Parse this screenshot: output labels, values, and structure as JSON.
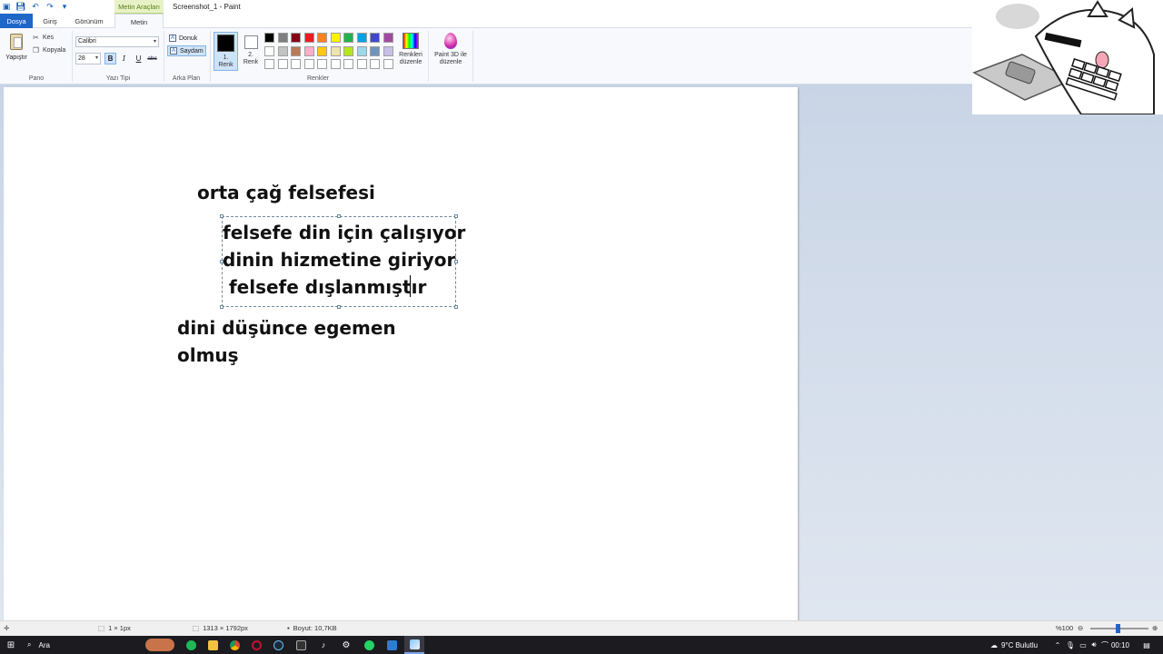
{
  "window": {
    "title": "Screenshot_1 - Paint",
    "context_tab_group": "Metin Araçları"
  },
  "tabs": {
    "file": "Dosya",
    "home": "Giriş",
    "view": "Görünüm",
    "text": "Metin"
  },
  "ribbon": {
    "clipboard": {
      "paste": "Yapıştır",
      "cut": "Kes",
      "copy": "Kopyala",
      "group": "Pano"
    },
    "font": {
      "family": "Calibri",
      "size": "28",
      "bold": "B",
      "italic": "I",
      "underline": "U",
      "strike": "abc",
      "group": "Yazı Tipi"
    },
    "background": {
      "opaque": "Donuk",
      "transparent": "Saydam",
      "group": "Arka Plan"
    },
    "colors": {
      "color1_line1": "1.",
      "color1_line2": "Renk",
      "color2_line1": "2.",
      "color2_line2": "Renk",
      "edit_line1": "Renkleri",
      "edit_line2": "düzenle",
      "group": "Renkler",
      "palette": [
        "#000000",
        "#7f7f7f",
        "#880015",
        "#ed1c24",
        "#ff7f27",
        "#fff200",
        "#22b14c",
        "#00a2e8",
        "#3f48cc",
        "#a349a4",
        "#ffffff",
        "#c3c3c3",
        "#b97a57",
        "#ffaec9",
        "#ffc90e",
        "#efe4b0",
        "#b5e61d",
        "#99d9ea",
        "#7092be",
        "#c8bfe7",
        "#ffffff",
        "#ffffff",
        "#ffffff",
        "#ffffff",
        "#ffffff",
        "#ffffff",
        "#ffffff",
        "#ffffff",
        "#ffffff",
        "#ffffff"
      ]
    },
    "paint3d_line1": "Paint 3D ile",
    "paint3d_line2": "düzenle"
  },
  "canvas": {
    "lines": [
      "orta çağ felsefesi",
      "felsefe din için çalışıyor",
      "dinin hizmetine giriyor",
      " felsefe dışlanmıştır",
      "dini düşünce egemen",
      "olmuş"
    ]
  },
  "status": {
    "cursor": "1 × 1px",
    "dimensions": "1313 × 1792px",
    "size": "Boyut: 10,7KB",
    "zoom": "%100"
  },
  "taskbar": {
    "search": "Ara",
    "weather": "9°C  Bulutlu",
    "time": "00:10"
  }
}
